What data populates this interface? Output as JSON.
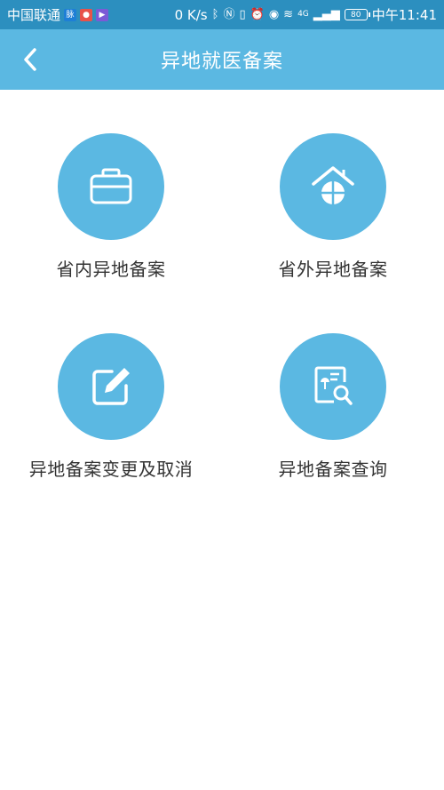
{
  "status_bar": {
    "carrier": "中国联通",
    "speed": "0 K/s",
    "network": "4G",
    "battery": "80",
    "time": "中午11:41",
    "badges": [
      "hd-badge",
      "map-pin-badge",
      "app-badge"
    ],
    "icons": [
      "bluetooth-icon",
      "nfc-icon",
      "vibrate-icon",
      "alarm-icon",
      "eye-icon",
      "wifi-icon",
      "signal-icon"
    ]
  },
  "header": {
    "title": "异地就医备案",
    "back_icon": "chevron-left-icon"
  },
  "menu": {
    "items": [
      {
        "label": "省内异地备案",
        "icon": "briefcase-icon"
      },
      {
        "label": "省外异地备案",
        "icon": "house-globe-icon"
      },
      {
        "label": "异地备案变更及取消",
        "icon": "edit-icon"
      },
      {
        "label": "异地备案查询",
        "icon": "document-search-icon"
      }
    ]
  },
  "colors": {
    "status_bar": "#2c8fbf",
    "header": "#5bb8e2",
    "icon_circle": "#5bb8e2",
    "label_text": "#333333"
  }
}
